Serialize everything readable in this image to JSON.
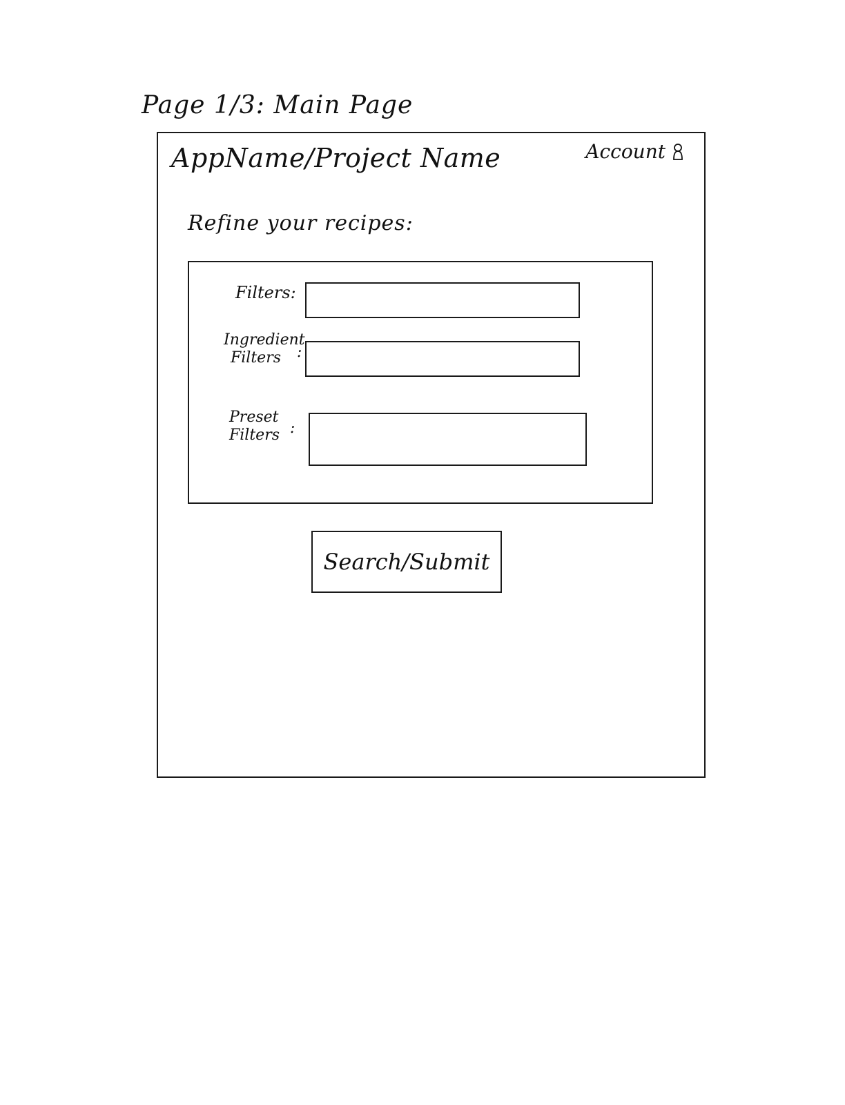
{
  "page_caption": "Page 1/3: Main Page",
  "header": {
    "app_title": "AppName/Project Name",
    "account_label": "Account"
  },
  "refine_heading": "Refine your recipes:",
  "filters": {
    "filters_label": "Filters:",
    "ingredient_label_line1": "Ingredient",
    "ingredient_label_line2": "Filters",
    "ingredient_colon": ":",
    "preset_label_line1": "Preset",
    "preset_label_line2": "Filters",
    "preset_colon": ":"
  },
  "submit_label": "Search/Submit",
  "icons": {
    "account": "person-icon"
  }
}
